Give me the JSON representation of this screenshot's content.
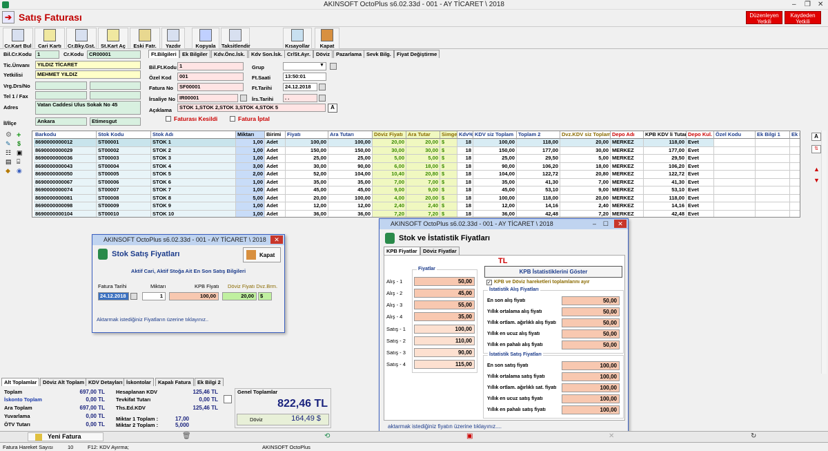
{
  "window": {
    "title": "AKINSOFT OctoPlus s6.02.33d  - 001 - AY TİCARET \\ 2018"
  },
  "form": {
    "title": "Satış Faturası",
    "btn_duzenleyen": "Düzenleyen\nYetkili",
    "btn_kaydeden": "Kaydeden\nYetkili"
  },
  "toolbar": [
    "Cr.Kart Bul",
    "Cari Kartı",
    "Cr.Bky.Gst.",
    "St.Kart Aç",
    "Eski Fatr.",
    "Yazdır",
    "Kopyala",
    "Taksitlendir",
    "Kısayollar",
    "Kapat"
  ],
  "cari": {
    "l_bilcr": "Bil.Cr.Kodu",
    "v_bilcr": "1",
    "l_crkodu": "Cr.Kodu",
    "v_crkodu": "CR00001",
    "l_unvan": "Tic.Ünvanı",
    "v_unvan": "YILDIZ TİCARET",
    "l_yetkili": "Yetkilisi",
    "v_yetkili": "MEHMET YILDIZ",
    "l_vrg": "Vrg.Drs/No",
    "l_tel": "Tel 1 / Fax",
    "l_adres": "Adres",
    "v_adres": "Vatan Caddesi Ulus Sokak No 45",
    "l_il": "İl/İlçe",
    "v_il": "Ankara",
    "v_ilce": "Etimesgut"
  },
  "tabs": [
    "Ft.Bilgileri",
    "Ek Bilgiler",
    "Kdv.Önc.İsk.",
    "Kdv Son.İsk.",
    "Cr/St.Ayr.",
    "Döviz",
    "Pazarlama",
    "Sevk Bilg.",
    "Fiyat Değiştirme"
  ],
  "fatura": {
    "l_bilft": "Bil.Ft.Kodu",
    "v_bilft": "1",
    "l_ozel": "Özel Kod",
    "v_ozel": "001",
    "l_fatno": "Fatura No",
    "v_fatno": "SF00001",
    "l_irs": "İrsaliye No",
    "v_irs": "IR00001",
    "l_acik": "Açıklama",
    "v_acik": "STOK 1,STOK 2,STOK 3,STOK 4,STOK 5",
    "l_grup": "Grup",
    "l_saat": "Ft.Saati",
    "v_saat": "13:50:01",
    "l_tarih": "Ft.Tarihi",
    "v_tarih": "24.12.2018",
    "l_irstarih": "İrs.Tarihi",
    "v_irstarih": ". .",
    "chk_kesildi": "Faturası Kesildi",
    "chk_iptal": "Fatura İptal",
    "btn_a": "A"
  },
  "grid": {
    "headers": [
      "Barkodu",
      "Stok Kodu",
      "Stok Adı",
      "Miktarı",
      "Birimi",
      "Fiyatı",
      "Ara Tutarı",
      "Döviz Fiyatı",
      "Ara Tutar",
      "Simge",
      "Kdv%",
      "KDV siz Toplam",
      "Toplam 2",
      "Dvz.KDV siz Toplam",
      "Depo Adı",
      "KPB KDV li Tutar",
      "Depo Kul.",
      "Özel Kodu",
      "Ek Bilgi 1",
      "Ek Bilgi 2",
      "Ek"
    ],
    "rows": [
      [
        "8690000000012",
        "ST00001",
        "STOK 1",
        "1,00",
        "Adet",
        "100,00",
        "100,00",
        "20,00",
        "20,00",
        "$",
        "18",
        "100,00",
        "118,00",
        "20,00",
        "MERKEZ",
        "118,00",
        "Evet"
      ],
      [
        "8690000000029",
        "ST00002",
        "STOK 2",
        "1,00",
        "Adet",
        "150,00",
        "150,00",
        "30,00",
        "30,00",
        "$",
        "18",
        "150,00",
        "177,00",
        "30,00",
        "MERKEZ",
        "177,00",
        "Evet"
      ],
      [
        "8690000000036",
        "ST00003",
        "STOK 3",
        "1,00",
        "Adet",
        "25,00",
        "25,00",
        "5,00",
        "5,00",
        "$",
        "18",
        "25,00",
        "29,50",
        "5,00",
        "MERKEZ",
        "29,50",
        "Evet"
      ],
      [
        "8690000000043",
        "ST00004",
        "STOK 4",
        "3,00",
        "Adet",
        "30,00",
        "90,00",
        "6,00",
        "18,00",
        "$",
        "18",
        "90,00",
        "106,20",
        "18,00",
        "MERKEZ",
        "106,20",
        "Evet"
      ],
      [
        "8690000000050",
        "ST00005",
        "STOK 5",
        "2,00",
        "Adet",
        "52,00",
        "104,00",
        "10,40",
        "20,80",
        "$",
        "18",
        "104,00",
        "122,72",
        "20,80",
        "MERKEZ",
        "122,72",
        "Evet"
      ],
      [
        "8690000000067",
        "ST00006",
        "STOK 6",
        "1,00",
        "Adet",
        "35,00",
        "35,00",
        "7,00",
        "7,00",
        "$",
        "18",
        "35,00",
        "41,30",
        "7,00",
        "MERKEZ",
        "41,30",
        "Evet"
      ],
      [
        "8690000000074",
        "ST00007",
        "STOK 7",
        "1,00",
        "Adet",
        "45,00",
        "45,00",
        "9,00",
        "9,00",
        "$",
        "18",
        "45,00",
        "53,10",
        "9,00",
        "MERKEZ",
        "53,10",
        "Evet"
      ],
      [
        "8690000000081",
        "ST00008",
        "STOK 8",
        "5,00",
        "Adet",
        "20,00",
        "100,00",
        "4,00",
        "20,00",
        "$",
        "18",
        "100,00",
        "118,00",
        "20,00",
        "MERKEZ",
        "118,00",
        "Evet"
      ],
      [
        "8690000000098",
        "ST00009",
        "STOK 9",
        "1,00",
        "Adet",
        "12,00",
        "12,00",
        "2,40",
        "2,40",
        "$",
        "18",
        "12,00",
        "14,16",
        "2,40",
        "MERKEZ",
        "14,16",
        "Evet"
      ],
      [
        "8690000000104",
        "ST00010",
        "STOK 10",
        "1,00",
        "Adet",
        "36,00",
        "36,00",
        "7,20",
        "7,20",
        "$",
        "18",
        "36,00",
        "42,48",
        "7,20",
        "MERKEZ",
        "42,48",
        "Evet"
      ]
    ]
  },
  "dlg1": {
    "title": "AKINSOFT OctoPlus s6.02.33d  - 001 - AY TİCARET \\ 2018",
    "head": "Stok Satış Fiyatları",
    "kapat": "Kapat",
    "info": "Aktif Cari, Aktif Stoğa Ait En Son Satış Bilgileri",
    "l_tarih": "Fatura Tarihi",
    "l_miktar": "Miktarı",
    "l_kpb": "KPB Fiyatı",
    "l_dvz": "Döviz Fiyatı Dvz.Brm.",
    "v_tarih": "24.12.2018",
    "v_miktar": "1",
    "v_kpb": "100,00",
    "v_dvz": "20,00",
    "v_brm": "$",
    "footer": "Aktarmak istediğiniz Fiyatların üzerine tıklayınız.."
  },
  "dlg2": {
    "title": "AKINSOFT OctoPlus s6.02.33d  - 001 - AY TİCARET \\ 2018",
    "head": "Stok ve İstatistik Fiyatları",
    "tab1": "KPB Fiyatlar",
    "tab2": "Döviz Fiyatlar",
    "tl": "TL",
    "grp_fiyat": "Fiyatlar",
    "labels": [
      "Alış - 1",
      "Alış - 2",
      "Alış - 3",
      "Alış - 4",
      "Satış - 1",
      "Satış - 2",
      "Satış - 3",
      "Satış - 4"
    ],
    "values": [
      "50,00",
      "45,00",
      "55,00",
      "35,00",
      "100,00",
      "110,00",
      "90,00",
      "115,00"
    ],
    "btn_stat": "KPB İstatistiklerini Göster",
    "chk": "KPB ve Döviz hareketleri toplamlarını ayır",
    "grp_alis": "İstatistik Alış Fiyatları",
    "alis_l": [
      "En son alış fiyatı",
      "Yıllık ortalama alış fiyatı",
      "Yıllık ortlam. ağırlıklı alış fiyatı",
      "Yıllık en ucuz alış fiyatı",
      "Yıllık en pahalı alış fiyatı"
    ],
    "alis_v": [
      "50,00",
      "50,00",
      "50,00",
      "50,00",
      "50,00"
    ],
    "grp_satis": "İstatistik Satış Fiyatları",
    "satis_l": [
      "En son satış fiyatı",
      "Yıllık ortalama satış fiyatı",
      "Yıllık ortlam. ağırlıklı sat. fiyatı",
      "Yıllık en ucuz satış fiyatı",
      "Yıllık en pahalı satış fiyatı"
    ],
    "satis_v": [
      "100,00",
      "100,00",
      "100,00",
      "100,00",
      "100,00"
    ],
    "footer": "aktarmak istediğiniz fiyatın üzerine tıklayınız...."
  },
  "btabs": [
    "Alt Toplamlar",
    "Döviz Alt Toplam",
    "KDV Detayları",
    "İskontolar",
    "Kapalı Fatura",
    "Ek Bilgi 2"
  ],
  "totals": {
    "l_toplam": "Toplam",
    "v_toplam": "697,00 TL",
    "l_isk": "İskonto Toplam",
    "v_isk": "0,00 TL",
    "l_ara": "Ara Toplam",
    "v_ara": "697,00 TL",
    "l_yuv": "Yuvarlama",
    "v_yuv": "0,00 TL",
    "l_otv": "ÖTV Tutarı",
    "v_otv": "0,00 TL",
    "l_hkdv": "Hesaplanan KDV",
    "v_hkdv": "125,46 TL",
    "l_tev": "Tevkifat Tutarı",
    "v_tev": "0,00 TL",
    "l_ths": "Ths.Ed.KDV",
    "v_ths": "125,46 TL",
    "l_m1": "Miktar 1 Toplam :",
    "v_m1": "17,00",
    "l_m2": "Miktar 2 Toplam :",
    "v_m2": "5,000",
    "l_genel": "Genel Toplamlar",
    "v_genel": "822,46 TL",
    "l_doviz": "Döviz",
    "v_doviz": "164,49 $"
  },
  "actions": {
    "yeni": "Yeni Fatura"
  },
  "status": {
    "l_sayi": "Fatura Hareket Sayısı",
    "v_sayi": "10",
    "f12": "F12: KDV Ayırma;",
    "app": "AKINSOFT OctoPlus"
  }
}
